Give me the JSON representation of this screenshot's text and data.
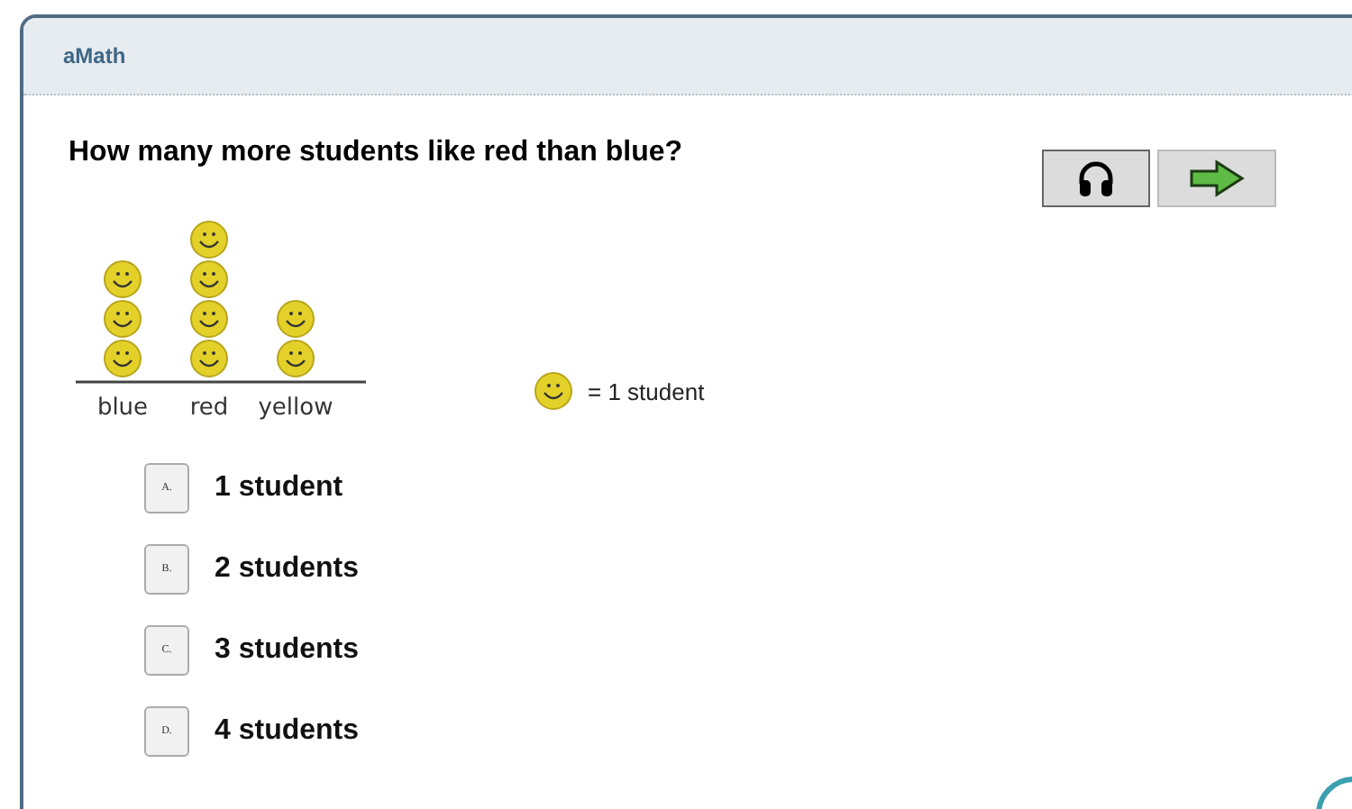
{
  "header": {
    "title": "aMath"
  },
  "question": "How many more students like red than blue?",
  "toolbar": [
    {
      "kind": "audio"
    },
    {
      "kind": "next"
    }
  ],
  "pictograph": {
    "columns": [
      {
        "label": "blue",
        "icons": [
          {
            "kind": "smiley"
          },
          {
            "kind": "smiley"
          },
          {
            "kind": "smiley"
          }
        ]
      },
      {
        "label": "red",
        "icons": [
          {
            "kind": "smiley"
          },
          {
            "kind": "smiley"
          },
          {
            "kind": "smiley"
          },
          {
            "kind": "smiley"
          }
        ]
      },
      {
        "label": "yellow",
        "icons": [
          {
            "kind": "smiley"
          },
          {
            "kind": "smiley"
          }
        ]
      }
    ]
  },
  "legend": "= 1 student",
  "options": [
    {
      "letter": "A.",
      "text": "1 student"
    },
    {
      "letter": "B.",
      "text": "2 students"
    },
    {
      "letter": "C.",
      "text": "3 students"
    },
    {
      "letter": "D.",
      "text": "4 students"
    }
  ]
}
